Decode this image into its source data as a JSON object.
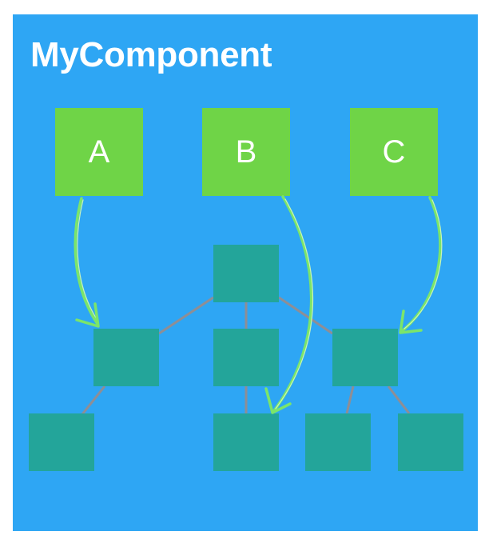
{
  "title": "MyComponent",
  "boxes": {
    "a": "A",
    "b": "B",
    "c": "C"
  },
  "colors": {
    "panel": "#2ea6f4",
    "source_box": "#6fd447",
    "tree_node": "#23a59a",
    "connector": "#8e8e95",
    "arrow": "#7be56a",
    "text": "#ffffff"
  }
}
